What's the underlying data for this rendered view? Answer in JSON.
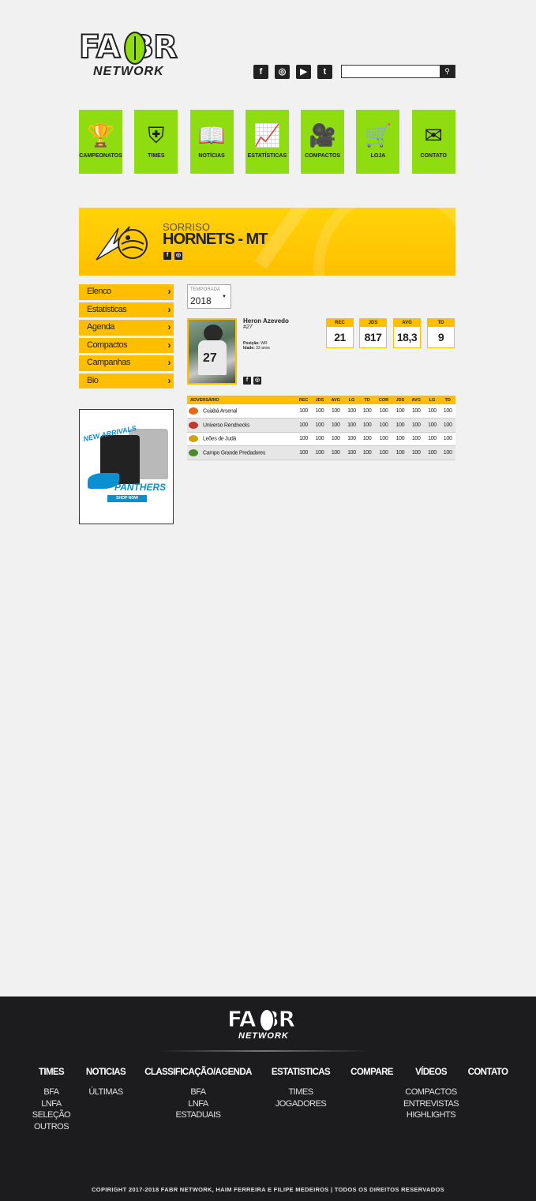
{
  "brand": {
    "logo_main": "FA BR",
    "logo_sub": "NETWORK",
    "accent": "#8fdc11",
    "yellow": "#ffbf00"
  },
  "social_top": [
    "facebook-icon",
    "instagram-icon",
    "youtube-icon",
    "twitter-icon"
  ],
  "search": {
    "placeholder": ""
  },
  "nav": [
    {
      "label": "CAMPEONATOS",
      "icon": "trophy-icon",
      "glyph": "🏆"
    },
    {
      "label": "TIMES",
      "icon": "shield-icon",
      "glyph": "⛨"
    },
    {
      "label": "NOTÍCIAS",
      "icon": "book-icon",
      "glyph": "📖"
    },
    {
      "label": "ESTATÍSTICAS",
      "icon": "chart-icon",
      "glyph": "📈"
    },
    {
      "label": "COMPACTOS",
      "icon": "video-camera-icon",
      "glyph": "🎥"
    },
    {
      "label": "LOJA",
      "icon": "cart-icon",
      "glyph": "🛒"
    },
    {
      "label": "CONTATO",
      "icon": "mail-icon",
      "glyph": "✉"
    }
  ],
  "team": {
    "city": "SORRISO",
    "name": "HORNETS - MT"
  },
  "side_menu": [
    "Elenco",
    "Estatísticas",
    "Agenda",
    "Compactos",
    "Campanhas",
    "Bio"
  ],
  "ad": {
    "new": "NEW ARRIVALS",
    "brand": "PANTHERS",
    "shop": "SHOP NOW"
  },
  "season": {
    "label": "TEMPORADA",
    "value": "2018"
  },
  "player": {
    "name": "Heron Azevedo",
    "number": "#27",
    "position_label": "Posição:",
    "position": "WR",
    "age_label": "Idade:",
    "age": "33 anos",
    "jersey": "27"
  },
  "stats": [
    {
      "label": "REC",
      "value": "21"
    },
    {
      "label": "JDS",
      "value": "817"
    },
    {
      "label": "AVG",
      "value": "18,3"
    },
    {
      "label": "TD",
      "value": "9"
    }
  ],
  "table": {
    "headers": [
      "ADVERSÁRIO",
      "REC",
      "JDS",
      "AVG",
      "LG",
      "TD",
      "COR",
      "JDS",
      "AVG",
      "LG",
      "TD"
    ],
    "rows": [
      {
        "team": "Cuiabá Arsenal",
        "color": "#e06a1a",
        "values": [
          "100",
          "100",
          "100",
          "100",
          "100",
          "100",
          "100",
          "100",
          "100",
          "100"
        ]
      },
      {
        "team": "Universo Rendnecks",
        "color": "#c0392b",
        "values": [
          "100",
          "100",
          "100",
          "100",
          "100",
          "100",
          "100",
          "100",
          "100",
          "100"
        ]
      },
      {
        "team": "Leões de Judá",
        "color": "#d4a017",
        "values": [
          "100",
          "100",
          "100",
          "100",
          "100",
          "100",
          "100",
          "100",
          "100",
          "100"
        ]
      },
      {
        "team": "Campo Grande Predadores",
        "color": "#4c8a2b",
        "values": [
          "100",
          "100",
          "100",
          "100",
          "100",
          "100",
          "100",
          "100",
          "100",
          "100"
        ]
      }
    ]
  },
  "footer": {
    "cols": [
      {
        "head": "TIMES",
        "items": [
          "BFA",
          "LNFA",
          "SELEÇÃO",
          "OUTROS"
        ]
      },
      {
        "head": "NOTICIAS",
        "items": [
          "ÚLTIMAS"
        ]
      },
      {
        "head": "CLASSIFICAÇÃO/AGENDA",
        "items": [
          "BFA",
          "LNFA",
          "ESTADUAIS"
        ]
      },
      {
        "head": "ESTATISTICAS",
        "items": [
          "TIMES",
          "JOGADORES"
        ]
      },
      {
        "head": "COMPARE",
        "items": []
      },
      {
        "head": "VÍDEOS",
        "items": [
          "COMPACTOS",
          "ENTREVISTAS",
          "HIGHLIGHTS"
        ]
      },
      {
        "head": "CONTATO",
        "items": []
      }
    ],
    "copyright": "COPIRIGHT 2017-2018 FABR NETWORK, HAIM FERREIRA E FILIPE MEDEIROS | TODOS OS DIREITOS RESERVADOS"
  }
}
